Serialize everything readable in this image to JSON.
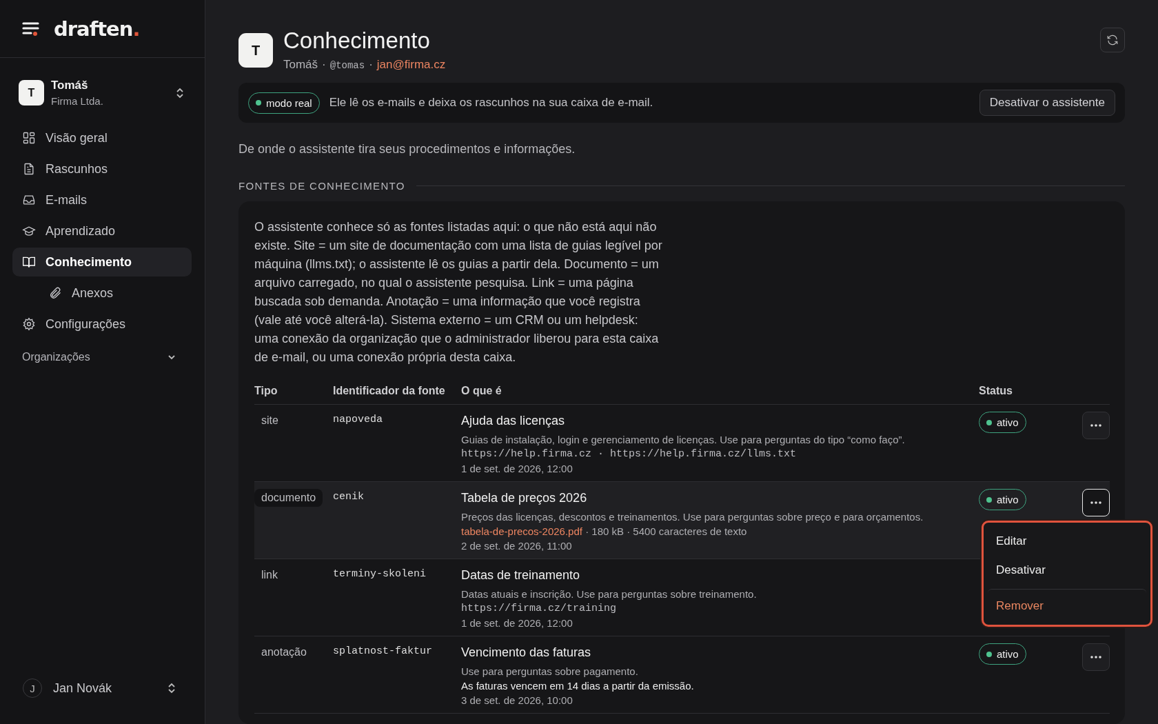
{
  "sidebar": {
    "logo": "draften",
    "logo_dot": ".",
    "account": {
      "avatar": "T",
      "name": "Tomáš",
      "org": "Firma Ltda."
    },
    "nav": [
      {
        "label": "Visão geral",
        "selected": false
      },
      {
        "label": "Rascunhos",
        "selected": false
      },
      {
        "label": "E-mails",
        "selected": false
      },
      {
        "label": "Aprendizado",
        "selected": false
      },
      {
        "label": "Conhecimento",
        "selected": true,
        "children": [
          {
            "label": "Anexos",
            "selected": false
          }
        ]
      },
      {
        "label": "Configurações",
        "selected": false
      }
    ],
    "section": {
      "label": "Organizações",
      "expanded": false
    },
    "user": {
      "avatar": "J",
      "name": "Jan Novák"
    }
  },
  "header": {
    "avatar": "T",
    "title": "Conhecimento",
    "name": "Tomáš",
    "handle": "@tomas",
    "separator": "·",
    "email": "jan@firma.cz"
  },
  "banner": {
    "mode": "modo real",
    "text": "Ele lê os e-mails e deixa os rascunhos na sua caixa de e-mail.",
    "button": "Desativar o assistente"
  },
  "description": "De onde o assistente tira seus procedimentos e informações.",
  "section_title": "FONTES DE CONHECIMENTO",
  "intro": "O assistente conhece só as fontes listadas aqui: o que não está aqui não existe. Site = um site de documentação com uma lista de guias legível por máquina (llms.txt); o assistente lê os guias a partir dela. Documento = um arquivo carregado, no qual o assistente pesquisa. Link = uma página buscada sob demanda. Anotação = uma informação que você registra (vale até você alterá-la). Sistema externo = um CRM ou um helpdesk: uma conexão da organização que o administrador liberou para esta caixa de e-mail, ou uma conexão própria desta caixa.",
  "table": {
    "columns": [
      "Tipo",
      "Identificador da fonte",
      "O que é",
      "Status"
    ],
    "rows": [
      {
        "type": "site",
        "id": "napoveda",
        "title": "Ajuda das licenças",
        "menu_open": false,
        "status": "ativo",
        "lines": [
          {
            "kind": "text",
            "text": "Guias de instalação, login e gerenciamento de licenças. Use para perguntas do tipo “como faço”."
          },
          {
            "kind": "mono",
            "text": "https://help.firma.cz · https://help.firma.cz/llms.txt"
          },
          {
            "kind": "date",
            "text": "1 de set. de 2026, 12:00"
          }
        ]
      },
      {
        "type": "documento",
        "id": "cenik",
        "title": "Tabela de preços 2026",
        "menu_open": true,
        "status": "ativo",
        "lines": [
          {
            "kind": "text",
            "text": "Preços das licenças, descontos e treinamentos. Use para perguntas sobre preço e para orçamentos."
          },
          {
            "kind": "file",
            "link": "tabela-de-precos-2026.pdf",
            "text": "· 180 kB · 5400 caracteres de texto"
          },
          {
            "kind": "date",
            "text": "2 de set. de 2026, 11:00"
          }
        ]
      },
      {
        "type": "link",
        "id": "terminy-skoleni",
        "title": "Datas de treinamento",
        "menu_open": false,
        "lines": [
          {
            "kind": "text",
            "text": "Datas atuais e inscrição. Use para perguntas sobre treinamento."
          },
          {
            "kind": "mono",
            "text": "https://firma.cz/training"
          },
          {
            "kind": "date",
            "text": "1 de set. de 2026, 12:00"
          }
        ]
      },
      {
        "type": "anotação",
        "id": "splatnost-faktur",
        "title": "Vencimento das faturas",
        "menu_open": false,
        "status": "ativo",
        "lines": [
          {
            "kind": "text",
            "text": "Use para perguntas sobre pagamento."
          },
          {
            "kind": "note",
            "text": "As faturas vencem em 14 dias a partir da emissão."
          },
          {
            "kind": "date",
            "text": "3 de set. de 2026, 10:00"
          }
        ]
      }
    ]
  },
  "menu": [
    {
      "label": "Editar",
      "kind": "normal"
    },
    {
      "label": "Desativar",
      "kind": "normal"
    },
    {
      "label": "Remover",
      "kind": "danger"
    }
  ]
}
